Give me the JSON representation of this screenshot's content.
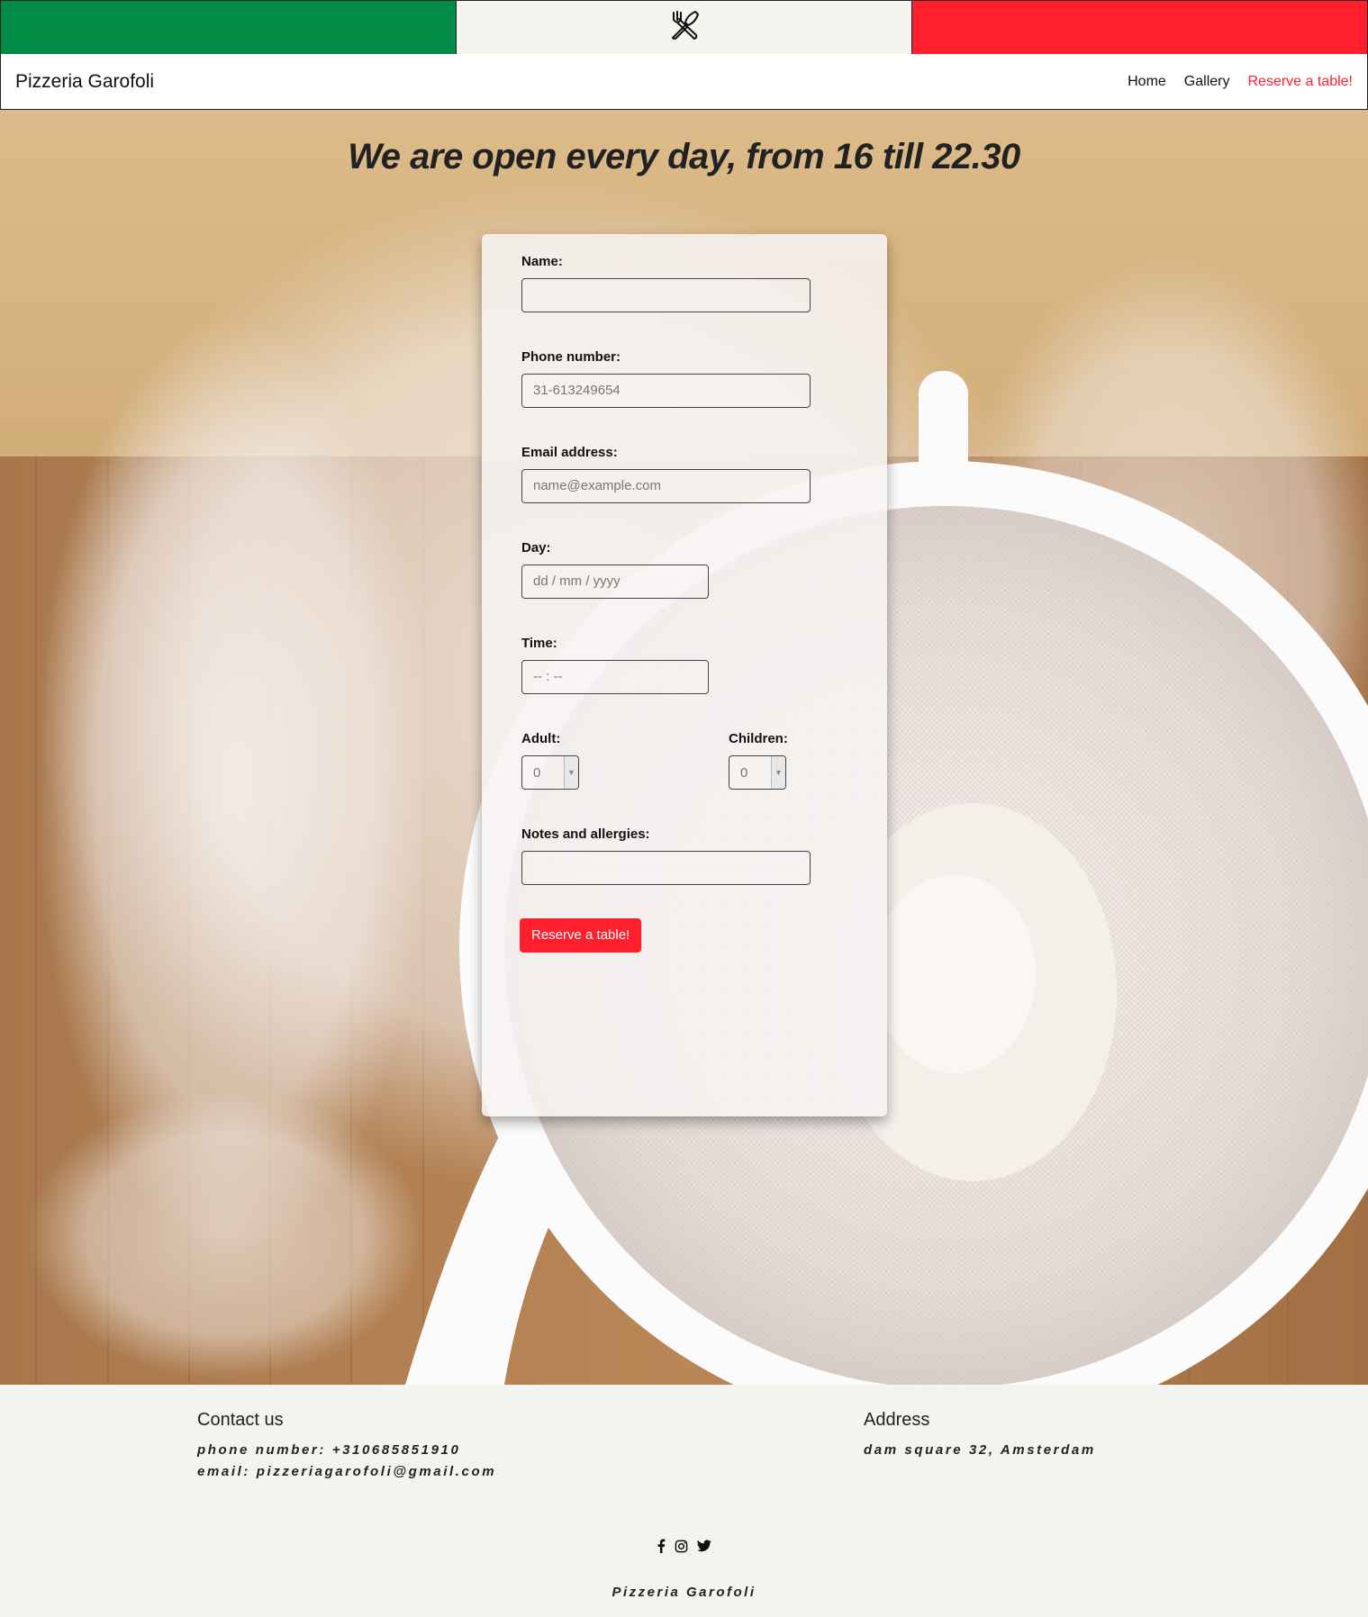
{
  "brand": "Pizzeria Garofoli",
  "nav": {
    "home": "Home",
    "gallery": "Gallery",
    "reserve": "Reserve a table!"
  },
  "hero": {
    "headline": "We are open every day, from 16 till 22.30"
  },
  "form": {
    "name_label": "Name:",
    "phone_label": "Phone number:",
    "phone_placeholder": "31-613249654",
    "email_label": "Email address:",
    "email_placeholder": "name@example.com",
    "day_label": "Day:",
    "day_placeholder": "dd / mm / yyyy",
    "time_label": "Time:",
    "time_placeholder": "-- : --",
    "adult_label": "Adult:",
    "adult_value": "0",
    "children_label": "Children:",
    "children_value": "0",
    "notes_label": "Notes and allergies:",
    "submit_label": "Reserve a table!"
  },
  "footer": {
    "contact_title": "Contact us",
    "phone_line": "phone number: +310685851910",
    "email_line": "email: pizzeriagarofoli@gmail.com",
    "address_title": "Address",
    "address_line": "dam square 32, Amsterdam",
    "copyright": "Pizzeria Garofoli"
  },
  "icons": [
    "utensils-icon",
    "facebook-icon",
    "instagram-icon",
    "twitter-icon"
  ],
  "colors": {
    "flag_green": "#008c45",
    "flag_white": "#f4f5f0",
    "flag_red": "#ff1f2d",
    "accent": "#ff1f2d"
  }
}
